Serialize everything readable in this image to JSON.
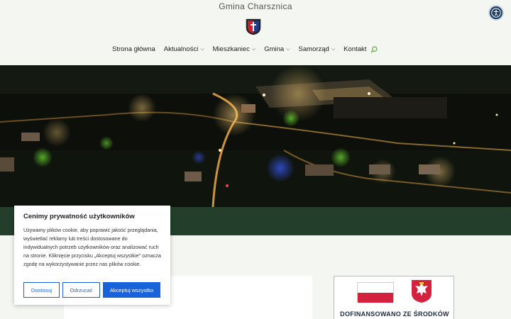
{
  "header": {
    "site_title": "Gmina Charsznica",
    "nav": [
      {
        "label": "Strona główna",
        "has_dropdown": false
      },
      {
        "label": "Aktualności",
        "has_dropdown": true
      },
      {
        "label": "Mieszkaniec",
        "has_dropdown": true
      },
      {
        "label": "Gmina",
        "has_dropdown": true
      },
      {
        "label": "Samorząd",
        "has_dropdown": true
      },
      {
        "label": "Kontakt",
        "has_dropdown": false
      }
    ],
    "search_icon": "search-icon",
    "accessibility_icon": "accessibility-icon"
  },
  "cookie_banner": {
    "title": "Cenimy prywatność użytkowników",
    "text": "Używamy plików cookie, aby poprawić jakość przeglądania, wyświetlać reklamy lub treści dostosowane do indywidualnych potrzeb użytkowników oraz analizować ruch na stronie. Kliknięcie przycisku „Akceptuj wszystkie\" oznacza zgodę na wykorzystywanie przez nas plików cookie.",
    "buttons": {
      "customize": "Dostosuj",
      "reject": "Odrzucać",
      "accept": "Akceptuj wszystko"
    }
  },
  "funding": {
    "text": "DOFINANSOWANO ZE ŚRODKÓW"
  },
  "colors": {
    "accent_green": "#233f2c",
    "cookie_blue": "#1863dc",
    "flag_red": "#d4213d"
  }
}
